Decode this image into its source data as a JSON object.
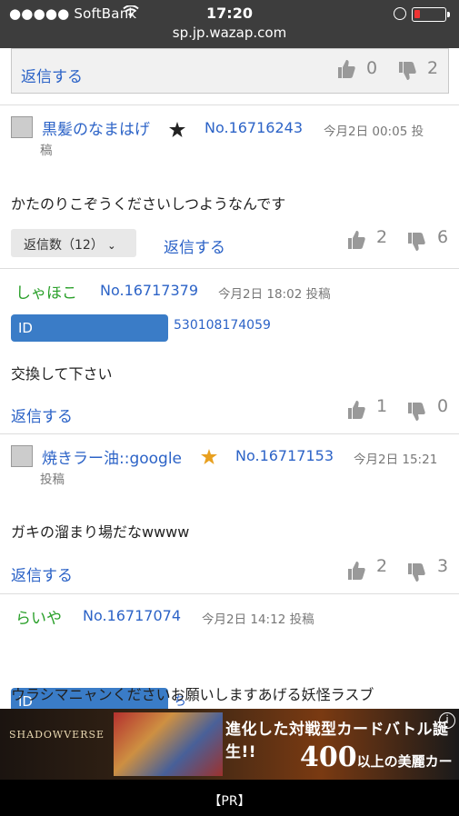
{
  "status_bar": {
    "carrier": "●●●●● SoftBank",
    "time": "17:20",
    "url": "sp.jp.wazap.com"
  },
  "top_box": {
    "reply_label": "返信する",
    "likes": "0",
    "dislikes": "2"
  },
  "posts": [
    {
      "author": "黒髪のなまはげ",
      "post_no": "No.16716243",
      "date": "今月2日 00:05 投稿",
      "date_line1": "今月2日 00:05 投",
      "date_line2": "稿",
      "body": "かたのりこぞうくださいしつようなんです",
      "reply_count": "返信数（12）",
      "reply_label": "返信する",
      "likes": "2",
      "dislikes": "6"
    },
    {
      "author": "しゃほこ",
      "post_no": "No.16717379",
      "date": "今月2日 18:02 投稿",
      "id_label": "ID",
      "id_value": "530108174059",
      "body": "交換して下さい",
      "reply_label": "返信する",
      "likes": "1",
      "dislikes": "0"
    },
    {
      "author": "焼きラー油::google",
      "post_no": "No.16717153",
      "date_line1": "今月2日 15:21",
      "date_line2": "投稿",
      "body": "ガキの溜まり場だなwwww",
      "reply_label": "返信する",
      "likes": "2",
      "dislikes": "3"
    },
    {
      "author": "らいや",
      "post_no": "No.16717074",
      "date": "今月2日 14:12 投稿",
      "id_label": "ID",
      "id_value": "ち",
      "body": "ウラシマニャンくださいお願いしますあげる妖怪ラスブ"
    }
  ],
  "ad": {
    "brand": "SHADOWVERSE",
    "headline": "進化した対戦型カードバトル誕生!!",
    "sub_number": "400",
    "sub_text": "以上の美麗カード",
    "info": "i"
  },
  "bottom_bar": {
    "label": "【PR】"
  },
  "colors": {
    "link": "#2c63c7",
    "green_author": "#2aa02a",
    "id_bar": "#3a7cc7"
  }
}
